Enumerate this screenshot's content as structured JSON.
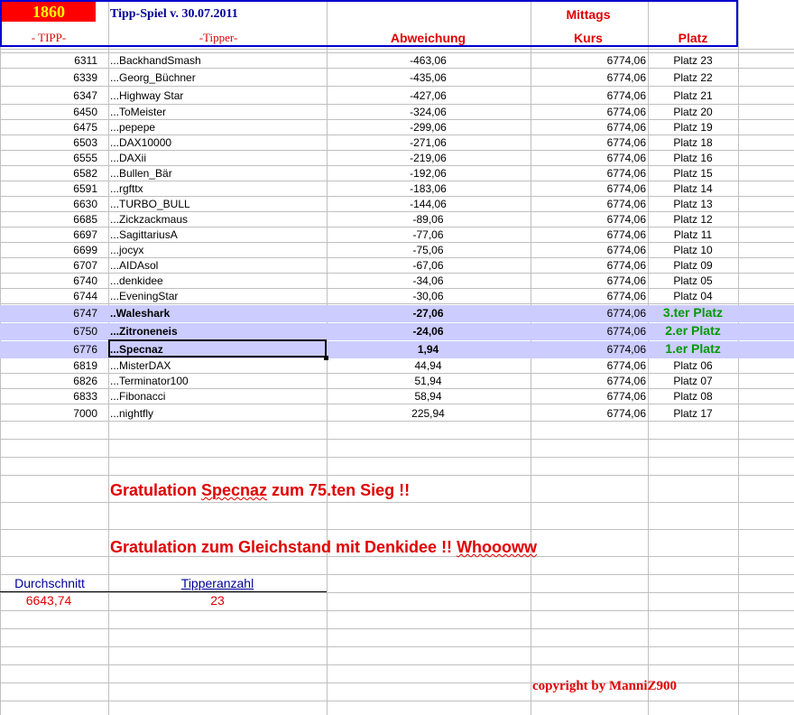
{
  "header": {
    "club": "1860",
    "title": "Tipp-Spiel v. 30.07.2011",
    "time": "Mittags",
    "col_tipp": "- TIPP-",
    "col_tipper": "-Tipper-",
    "col_abweichung": "Abweichung",
    "col_kurs": "Kurs",
    "col_platz": "Platz"
  },
  "rows": [
    {
      "tipp": "6311",
      "name": "...BackhandSmash",
      "abw": "-463,06",
      "kurs": "6774,06",
      "platz": "Platz 23"
    },
    {
      "tipp": "6339",
      "name": "...Georg_Büchner",
      "abw": "-435,06",
      "kurs": "6774,06",
      "platz": "Platz 22"
    },
    {
      "tipp": "6347",
      "name": "...Highway Star",
      "abw": "-427,06",
      "kurs": "6774,06",
      "platz": "Platz 21"
    },
    {
      "tipp": "6450",
      "name": "...ToMeister",
      "abw": "-324,06",
      "kurs": "6774,06",
      "platz": "Platz 20"
    },
    {
      "tipp": "6475",
      "name": "...pepepe",
      "abw": "-299,06",
      "kurs": "6774,06",
      "platz": "Platz 19"
    },
    {
      "tipp": "6503",
      "name": "...DAX10000",
      "abw": "-271,06",
      "kurs": "6774,06",
      "platz": "Platz 18"
    },
    {
      "tipp": "6555",
      "name": "...DAXii",
      "abw": "-219,06",
      "kurs": "6774,06",
      "platz": "Platz 16"
    },
    {
      "tipp": "6582",
      "name": "...Bullen_Bär",
      "abw": "-192,06",
      "kurs": "6774,06",
      "platz": "Platz 15"
    },
    {
      "tipp": "6591",
      "name": "...rgfttx",
      "abw": "-183,06",
      "kurs": "6774,06",
      "platz": "Platz 14"
    },
    {
      "tipp": "6630",
      "name": "...TURBO_BULL",
      "abw": "-144,06",
      "kurs": "6774,06",
      "platz": "Platz 13"
    },
    {
      "tipp": "6685",
      "name": "...Zickzackmaus",
      "abw": "-89,06",
      "kurs": "6774,06",
      "platz": "Platz 12"
    },
    {
      "tipp": "6697",
      "name": "...SagittariusA",
      "abw": "-77,06",
      "kurs": "6774,06",
      "platz": "Platz 11"
    },
    {
      "tipp": "6699",
      "name": "...jocyx",
      "abw": "-75,06",
      "kurs": "6774,06",
      "platz": "Platz 10"
    },
    {
      "tipp": "6707",
      "name": "...AIDAsol",
      "abw": "-67,06",
      "kurs": "6774,06",
      "platz": "Platz 09"
    },
    {
      "tipp": "6740",
      "name": "...denkidee",
      "abw": "-34,06",
      "kurs": "6774,06",
      "platz": "Platz 05"
    },
    {
      "tipp": "6744",
      "name": "...EveningStar",
      "abw": "-30,06",
      "kurs": "6774,06",
      "platz": "Platz 04"
    },
    {
      "tipp": "6747",
      "name": "..Waleshark",
      "abw": "-27,06",
      "kurs": "6774,06",
      "platz": "3.ter Platz"
    },
    {
      "tipp": "6750",
      "name": "...Zitroneneis",
      "abw": "-24,06",
      "kurs": "6774,06",
      "platz": "2.er Platz"
    },
    {
      "tipp": "6776",
      "name": "...Specnaz",
      "abw": "1,94",
      "kurs": "6774,06",
      "platz": "1.er Platz"
    },
    {
      "tipp": "6819",
      "name": "...MisterDAX",
      "abw": "44,94",
      "kurs": "6774,06",
      "platz": "Platz 06"
    },
    {
      "tipp": "6826",
      "name": "...Terminator100",
      "abw": "51,94",
      "kurs": "6774,06",
      "platz": "Platz 07"
    },
    {
      "tipp": "6833",
      "name": "...Fibonacci",
      "abw": "58,94",
      "kurs": "6774,06",
      "platz": "Platz 08"
    },
    {
      "tipp": "7000",
      "name": "...nightfly",
      "abw": "225,94",
      "kurs": "6774,06",
      "platz": "Platz 17"
    }
  ],
  "messages": {
    "msg1_a": "Gratulation ",
    "msg1_b": "Specnaz",
    "msg1_c": " zum  75.ten Sieg !!",
    "msg2_a": "Gratulation zum Gleichstand mit Denkidee !! ",
    "msg2_b": "Whoooww"
  },
  "summary": {
    "avg_label": "Durchschnitt",
    "avg_value": "6643,74",
    "count_label": "Tipperanzahl",
    "count_value": "23"
  },
  "copyright": "copyright by ManniZ900",
  "colors": {
    "accent_red": "#e00000",
    "header_blue": "#0000cc",
    "highlight": "#ccccff",
    "podium_green": "#009900"
  }
}
